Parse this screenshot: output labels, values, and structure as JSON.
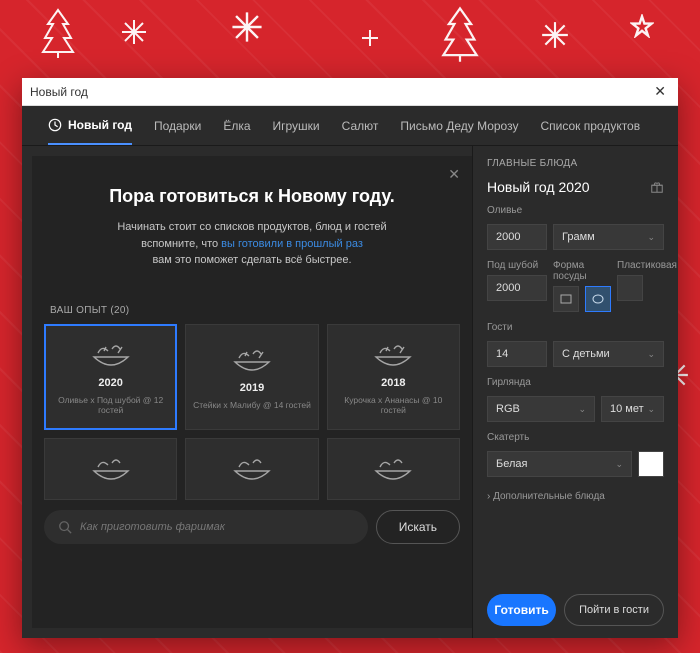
{
  "window": {
    "title": "Новый год"
  },
  "tabs": [
    {
      "label": "Новый год",
      "active": true
    },
    {
      "label": "Подарки"
    },
    {
      "label": "Ёлка"
    },
    {
      "label": "Игрушки"
    },
    {
      "label": "Салют"
    },
    {
      "label": "Письмо Деду Морозу"
    },
    {
      "label": "Список продуктов"
    }
  ],
  "banner": {
    "title": "Пора готовиться к Новому году.",
    "line1": "Начинать стоит со списков продуктов, блюд и гостей",
    "line2a": "вспомните, что ",
    "link": "вы готовили в прошлый раз",
    "line3": "вам это поможет сделать всё быстрее."
  },
  "experience": {
    "label": "ВАШ ОПЫТ (20)",
    "cards": [
      {
        "year": "2020",
        "sub": "Оливье x Под шубой @ 12 гостей",
        "selected": true
      },
      {
        "year": "2019",
        "sub": "Стейки x Малибу @ 14 гостей"
      },
      {
        "year": "2018",
        "sub": "Курочка x Ананасы @ 10 гостей"
      }
    ]
  },
  "search": {
    "placeholder": "Как приготовить фаршмак",
    "button": "Искать"
  },
  "panel": {
    "title": "ГЛАВНЫЕ БЛЮДА",
    "doc_name": "Новый год 2020",
    "olivier": {
      "label": "Оливье",
      "value": "2000",
      "unit": "Грамм"
    },
    "shuba": {
      "label": "Под шубой",
      "value": "2000"
    },
    "dishform": {
      "label": "Форма посуды"
    },
    "plastic": {
      "label": "Пластиковая"
    },
    "guests": {
      "label": "Гости",
      "value": "14",
      "option": "С детьми"
    },
    "garland": {
      "label": "Гирлянда",
      "value": "RGB",
      "len": "10 мет"
    },
    "tablecloth": {
      "label": "Скатерть",
      "value": "Белая"
    },
    "more": "Дополнительные блюда",
    "primary": "Готовить",
    "secondary": "Пойти в гости"
  }
}
